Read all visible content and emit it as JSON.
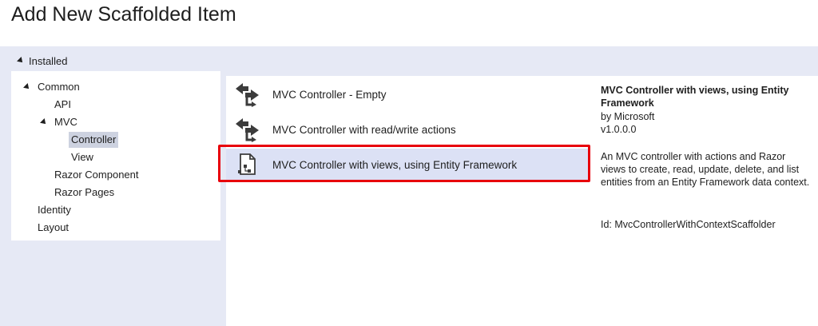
{
  "dialog": {
    "title": "Add New Scaffolded Item"
  },
  "installed": {
    "label": "Installed"
  },
  "tree": {
    "items": [
      {
        "label": "Common",
        "expanded": true
      },
      {
        "label": "API"
      },
      {
        "label": "MVC",
        "expanded": true
      },
      {
        "label": "Controller",
        "selected": true
      },
      {
        "label": "View"
      },
      {
        "label": "Razor Component"
      },
      {
        "label": "Razor Pages"
      },
      {
        "label": "Identity"
      },
      {
        "label": "Layout"
      }
    ]
  },
  "templates": {
    "items": [
      {
        "label": "MVC Controller - Empty",
        "icon": "controller-arrows-icon"
      },
      {
        "label": "MVC Controller with read/write actions",
        "icon": "controller-arrows-icon"
      },
      {
        "label": "MVC Controller with views, using Entity Framework",
        "icon": "scaffold-document-icon",
        "selected": true
      }
    ]
  },
  "details": {
    "title": "MVC Controller with views, using Entity Framework",
    "author": "by Microsoft",
    "version": "v1.0.0.0",
    "description": "An MVC controller with actions and Razor views to create, read, update, delete, and list entities from an Entity Framework data context.",
    "id": "Id: MvcControllerWithContextScaffolder"
  },
  "colors": {
    "panel_bg": "#e6e9f5",
    "selection": "#dce1f5",
    "highlight": "#e8000b"
  }
}
